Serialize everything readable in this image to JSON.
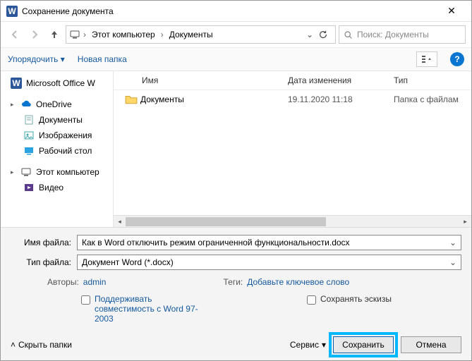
{
  "title": "Сохранение документа",
  "breadcrumb": {
    "root_icon": "pc",
    "item1": "Этот компьютер",
    "item2": "Документы"
  },
  "search": {
    "placeholder": "Поиск: Документы"
  },
  "toolbar": {
    "organize": "Упорядочить",
    "newfolder": "Новая папка"
  },
  "tree": {
    "office": "Microsoft Office W",
    "onedrive": "OneDrive",
    "docs": "Документы",
    "pics": "Изображения",
    "desk": "Рабочий стол",
    "pc": "Этот компьютер",
    "video": "Видео"
  },
  "columns": {
    "name": "Имя",
    "date": "Дата изменения",
    "type": "Тип"
  },
  "rows": [
    {
      "name": "Документы",
      "date": "19.11.2020 11:18",
      "type": "Папка с файлам"
    }
  ],
  "fields": {
    "filename_label": "Имя файла:",
    "filename_value": "Как в Word отключить режим ограниченной функциональности.docx",
    "filetype_label": "Тип файла:",
    "filetype_value": "Документ Word (*.docx)"
  },
  "meta": {
    "authors_label": "Авторы:",
    "authors_value": "admin",
    "tags_label": "Теги:",
    "tags_value": "Добавьте ключевое слово"
  },
  "checks": {
    "compat": "Поддерживать совместимость с Word 97-2003",
    "thumbs": "Сохранять эскизы"
  },
  "footer": {
    "hide": "Скрыть папки",
    "service": "Сервис",
    "save": "Сохранить",
    "cancel": "Отмена"
  }
}
